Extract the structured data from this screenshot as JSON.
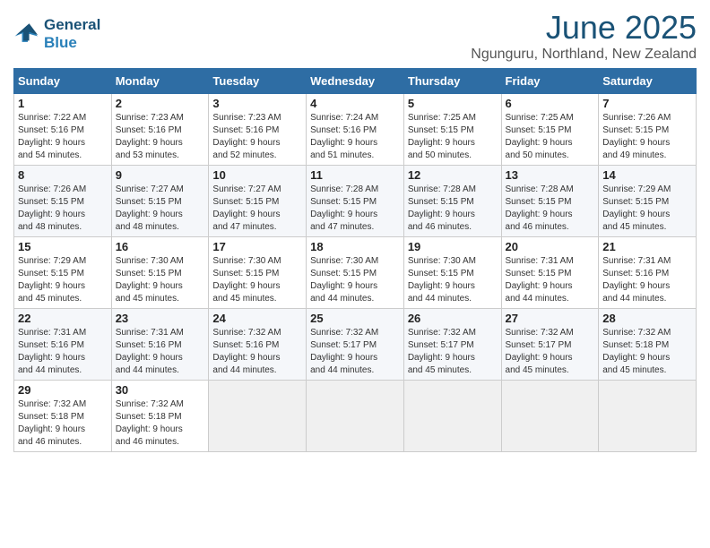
{
  "header": {
    "logo_line1": "General",
    "logo_line2": "Blue",
    "month": "June 2025",
    "location": "Ngunguru, Northland, New Zealand"
  },
  "days_of_week": [
    "Sunday",
    "Monday",
    "Tuesday",
    "Wednesday",
    "Thursday",
    "Friday",
    "Saturday"
  ],
  "weeks": [
    [
      {
        "day": 1,
        "rise": "7:22 AM",
        "set": "5:16 PM",
        "daylight": "9 hours and 54 minutes."
      },
      {
        "day": 2,
        "rise": "7:23 AM",
        "set": "5:16 PM",
        "daylight": "9 hours and 53 minutes."
      },
      {
        "day": 3,
        "rise": "7:23 AM",
        "set": "5:16 PM",
        "daylight": "9 hours and 52 minutes."
      },
      {
        "day": 4,
        "rise": "7:24 AM",
        "set": "5:16 PM",
        "daylight": "9 hours and 51 minutes."
      },
      {
        "day": 5,
        "rise": "7:25 AM",
        "set": "5:15 PM",
        "daylight": "9 hours and 50 minutes."
      },
      {
        "day": 6,
        "rise": "7:25 AM",
        "set": "5:15 PM",
        "daylight": "9 hours and 50 minutes."
      },
      {
        "day": 7,
        "rise": "7:26 AM",
        "set": "5:15 PM",
        "daylight": "9 hours and 49 minutes."
      }
    ],
    [
      {
        "day": 8,
        "rise": "7:26 AM",
        "set": "5:15 PM",
        "daylight": "9 hours and 48 minutes."
      },
      {
        "day": 9,
        "rise": "7:27 AM",
        "set": "5:15 PM",
        "daylight": "9 hours and 48 minutes."
      },
      {
        "day": 10,
        "rise": "7:27 AM",
        "set": "5:15 PM",
        "daylight": "9 hours and 47 minutes."
      },
      {
        "day": 11,
        "rise": "7:28 AM",
        "set": "5:15 PM",
        "daylight": "9 hours and 47 minutes."
      },
      {
        "day": 12,
        "rise": "7:28 AM",
        "set": "5:15 PM",
        "daylight": "9 hours and 46 minutes."
      },
      {
        "day": 13,
        "rise": "7:28 AM",
        "set": "5:15 PM",
        "daylight": "9 hours and 46 minutes."
      },
      {
        "day": 14,
        "rise": "7:29 AM",
        "set": "5:15 PM",
        "daylight": "9 hours and 45 minutes."
      }
    ],
    [
      {
        "day": 15,
        "rise": "7:29 AM",
        "set": "5:15 PM",
        "daylight": "9 hours and 45 minutes."
      },
      {
        "day": 16,
        "rise": "7:30 AM",
        "set": "5:15 PM",
        "daylight": "9 hours and 45 minutes."
      },
      {
        "day": 17,
        "rise": "7:30 AM",
        "set": "5:15 PM",
        "daylight": "9 hours and 45 minutes."
      },
      {
        "day": 18,
        "rise": "7:30 AM",
        "set": "5:15 PM",
        "daylight": "9 hours and 44 minutes."
      },
      {
        "day": 19,
        "rise": "7:30 AM",
        "set": "5:15 PM",
        "daylight": "9 hours and 44 minutes."
      },
      {
        "day": 20,
        "rise": "7:31 AM",
        "set": "5:15 PM",
        "daylight": "9 hours and 44 minutes."
      },
      {
        "day": 21,
        "rise": "7:31 AM",
        "set": "5:16 PM",
        "daylight": "9 hours and 44 minutes."
      }
    ],
    [
      {
        "day": 22,
        "rise": "7:31 AM",
        "set": "5:16 PM",
        "daylight": "9 hours and 44 minutes."
      },
      {
        "day": 23,
        "rise": "7:31 AM",
        "set": "5:16 PM",
        "daylight": "9 hours and 44 minutes."
      },
      {
        "day": 24,
        "rise": "7:32 AM",
        "set": "5:16 PM",
        "daylight": "9 hours and 44 minutes."
      },
      {
        "day": 25,
        "rise": "7:32 AM",
        "set": "5:17 PM",
        "daylight": "9 hours and 44 minutes."
      },
      {
        "day": 26,
        "rise": "7:32 AM",
        "set": "5:17 PM",
        "daylight": "9 hours and 45 minutes."
      },
      {
        "day": 27,
        "rise": "7:32 AM",
        "set": "5:17 PM",
        "daylight": "9 hours and 45 minutes."
      },
      {
        "day": 28,
        "rise": "7:32 AM",
        "set": "5:18 PM",
        "daylight": "9 hours and 45 minutes."
      }
    ],
    [
      {
        "day": 29,
        "rise": "7:32 AM",
        "set": "5:18 PM",
        "daylight": "9 hours and 46 minutes."
      },
      {
        "day": 30,
        "rise": "7:32 AM",
        "set": "5:18 PM",
        "daylight": "9 hours and 46 minutes."
      },
      null,
      null,
      null,
      null,
      null
    ]
  ],
  "labels": {
    "sunrise": "Sunrise:",
    "sunset": "Sunset:",
    "daylight": "Daylight:"
  }
}
